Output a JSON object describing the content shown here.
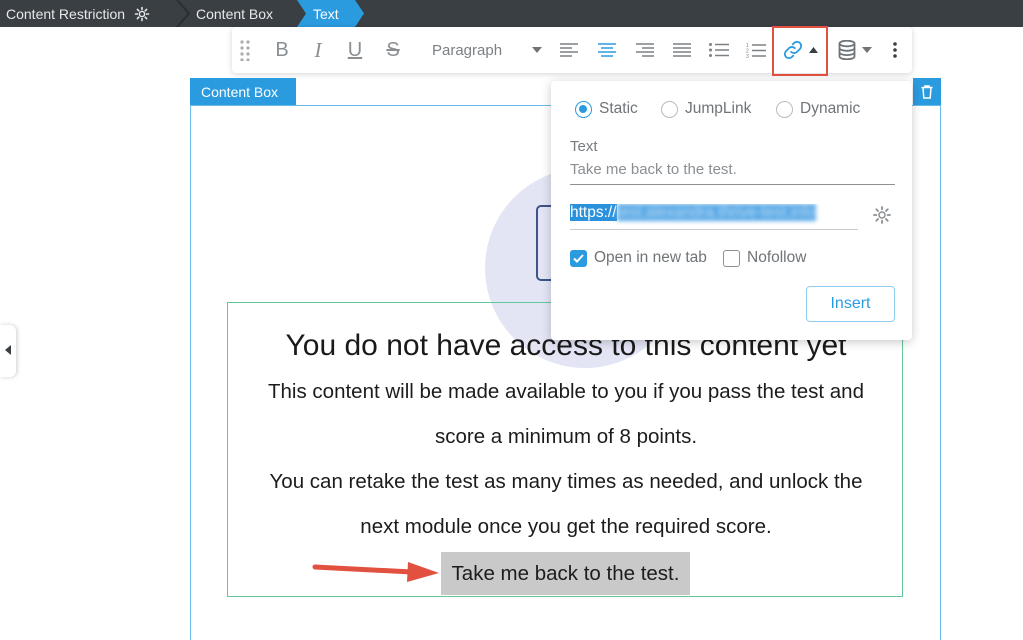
{
  "breadcrumb": {
    "items": [
      {
        "label": "Content Restriction"
      },
      {
        "label": "Content Box"
      },
      {
        "label": "Text"
      }
    ]
  },
  "toolbar": {
    "paragraph_style": "Paragraph",
    "buttons": [
      "drag-handle",
      "bold",
      "italic",
      "underline",
      "strikethrough",
      "paragraph-style",
      "align-left",
      "align-center",
      "align-right",
      "justify",
      "bullet-list",
      "numbered-list",
      "link",
      "database",
      "more"
    ],
    "active_alignment": "center",
    "highlighted_button": "link"
  },
  "content_box": {
    "label": "Content Box",
    "heading": "You do not have access to this content yet",
    "paragraphs": [
      "This content will be made available to you if you pass the test and",
      "score a minimum of 8 points.",
      "You can retake the test as many times as needed, and unlock the",
      "next module once you get the required score."
    ],
    "link_text": "Take me back to the test."
  },
  "link_popup": {
    "link_types": [
      {
        "label": "Static",
        "selected": true
      },
      {
        "label": "JumpLink",
        "selected": false
      },
      {
        "label": "Dynamic",
        "selected": false
      }
    ],
    "text_label": "Text",
    "text_value": "Take me back to the test.",
    "url_visible": "https://",
    "url_obscured": "test.alexandra.thrive-test.info",
    "options": [
      {
        "label": "Open in new tab",
        "checked": true
      },
      {
        "label": "Nofollow",
        "checked": false
      }
    ],
    "insert_label": "Insert"
  },
  "colors": {
    "accent": "#2b9be0",
    "breadcrumb_bg": "#3a3f44",
    "highlight_border": "#e2513f",
    "arrow": "#e2513f",
    "text_box_border": "#63c79a",
    "link_selection_bg": "#c9c9c9"
  }
}
